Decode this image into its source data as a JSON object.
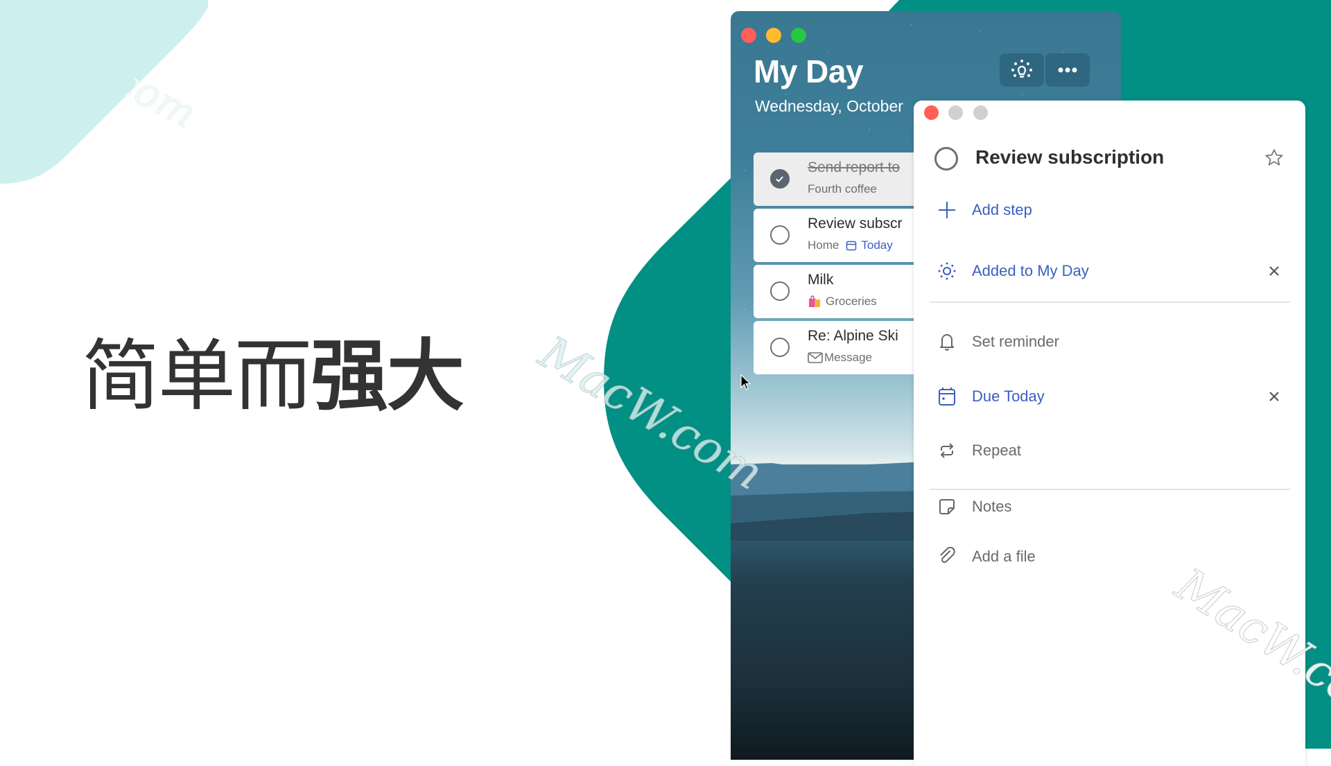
{
  "slide": {
    "headline_light": "简单而",
    "headline_bold": "强大",
    "watermark": "MacW.com",
    "colors": {
      "teal": "#028f84",
      "light_teal": "#cdf0ee",
      "accent_blue": "#3a5fc0",
      "headline": "#333333"
    }
  },
  "myday_window": {
    "traffic_lights": [
      "#ff5f57",
      "#febc2e",
      "#28c840"
    ],
    "title": "My Day",
    "date": "Wednesday, October",
    "buttons": [
      {
        "name": "suggestions",
        "icon": "lightbulb-icon"
      },
      {
        "name": "more",
        "icon": "more-icon"
      }
    ],
    "tasks": [
      {
        "title": "Send report to",
        "subtitle": "Fourth coffee",
        "completed": true
      },
      {
        "title": "Review subscr",
        "subtitle": "Home",
        "due_label": "Today",
        "due_icon": "calendar-icon",
        "completed": false
      },
      {
        "title": "Milk",
        "subtitle": "Groceries",
        "subtitle_icon": "shopping-bags-icon",
        "completed": false
      },
      {
        "title": "Re: Alpine Ski",
        "subtitle": "Message",
        "subtitle_icon": "mail-icon",
        "completed": false
      }
    ]
  },
  "detail_window": {
    "traffic_lights": [
      "#ff5f57",
      "#d0d0d0",
      "#d0d0d0"
    ],
    "title": "Review subscription",
    "add_step": "Add step",
    "added_to_my_day": "Added to My Day",
    "set_reminder": "Set reminder",
    "due": "Due Today",
    "repeat": "Repeat",
    "notes": "Notes",
    "add_file": "Add a file"
  }
}
